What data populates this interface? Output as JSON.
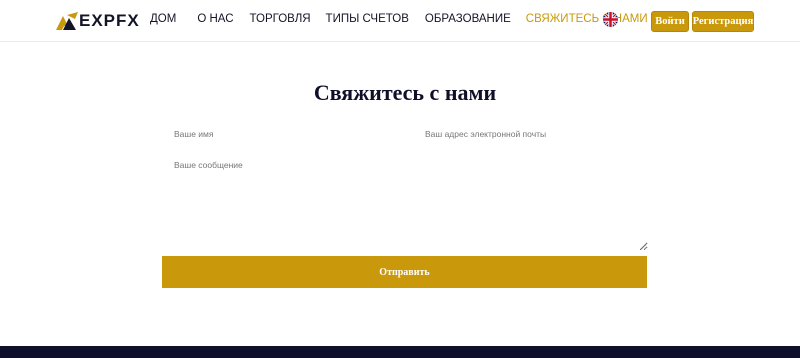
{
  "brand": {
    "logo_text": "EXPFX",
    "accent_color": "#c9990b",
    "dark_color": "#0d0f2b"
  },
  "nav": {
    "items": [
      {
        "label": "ДОМ"
      },
      {
        "label": "О НАС"
      },
      {
        "label": "ТОРГОВЛЯ"
      },
      {
        "label": "ТИПЫ СЧЕТОВ"
      },
      {
        "label": "ОБРАЗОВАНИЕ"
      },
      {
        "label": "СВЯЖИТЕСЬ С НАМИ",
        "active": true
      }
    ],
    "language_icon": "uk-flag-icon"
  },
  "auth": {
    "login_label": "Войти",
    "register_label": "Регистрация"
  },
  "contact": {
    "title": "Свяжитесь с нами",
    "name_placeholder": "Ваше имя",
    "email_placeholder": "Ваш адрес электронной почты",
    "message_placeholder": "Ваше сообщение",
    "submit_label": "Отправить"
  }
}
